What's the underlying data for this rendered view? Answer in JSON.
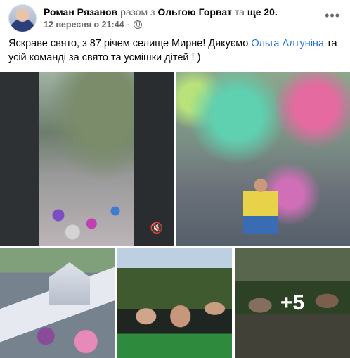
{
  "header": {
    "author": "Роман Рязанов",
    "with_word": "разом з",
    "tagged": "Ольгою Горват",
    "and_word": "та",
    "others": "ще 20",
    "period": ".",
    "date": "12 вересня о 21:44",
    "separator": "·",
    "privacy_icon": "globe-icon",
    "menu_icon": "more-options-icon"
  },
  "post": {
    "text_before": "Яскраве свято, з 87 річем селище Мирне! Дякуємо ",
    "mention": "Ольга Алтуніна",
    "text_after": " та усій команді за свято та усмішки дітей ! )"
  },
  "media": {
    "video_icon": "muted-speaker-icon",
    "more_photos": "+5"
  },
  "colors": {
    "link": "#216fdb",
    "muted_text": "#65676b",
    "text": "#050505"
  }
}
